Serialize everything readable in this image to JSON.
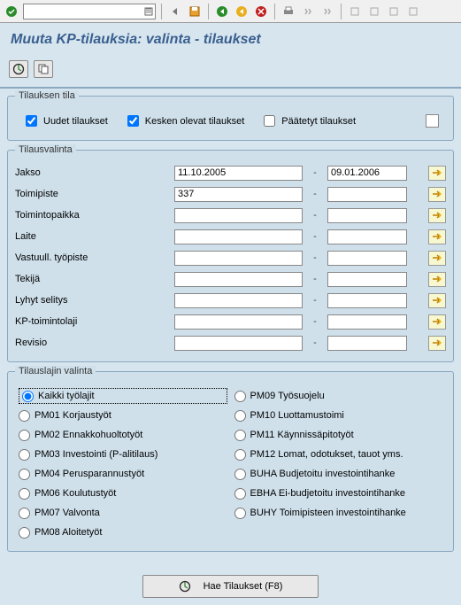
{
  "title": "Muuta KP-tilauksia: valinta - tilaukset",
  "status": {
    "group_title": "Tilauksen tila",
    "new": "Uudet tilaukset",
    "open": "Kesken olevat tilaukset",
    "closed": "Päätetyt tilaukset",
    "new_checked": true,
    "open_checked": true,
    "closed_checked": false
  },
  "selection": {
    "group_title": "Tilausvalinta",
    "rows": [
      {
        "label": "Jakso",
        "from": "11.10.2005",
        "to": "09.01.2006"
      },
      {
        "label": "Toimipiste",
        "from": "337",
        "to": ""
      },
      {
        "label": "Toimintopaikka",
        "from": "",
        "to": ""
      },
      {
        "label": "Laite",
        "from": "",
        "to": ""
      },
      {
        "label": "Vastuull. työpiste",
        "from": "",
        "to": ""
      },
      {
        "label": "Tekijä",
        "from": "",
        "to": ""
      },
      {
        "label": "Lyhyt selitys",
        "from": "",
        "to": ""
      },
      {
        "label": "KP-toimintolaji",
        "from": "",
        "to": ""
      },
      {
        "label": "Revisio",
        "from": "",
        "to": ""
      }
    ]
  },
  "ordertype": {
    "group_title": "Tilauslajin valinta",
    "left": [
      "Kaikki työlajit",
      "PM01 Korjaustyöt",
      "PM02 Ennakkohuoltotyöt",
      "PM03 Investointi (P-alitilaus)",
      "PM04 Perusparannustyöt",
      "PM06 Koulutustyöt",
      "PM07 Valvonta",
      "PM08 Aloitetyöt"
    ],
    "right": [
      "PM09 Työsuojelu",
      "PM10 Luottamustoimi",
      "PM11 Käynnissäpitotyöt",
      "PM12 Lomat, odotukset, tauot yms.",
      "BUHA Budjetoitu investointihanke",
      "EBHA Ei-budjetoitu investointihanke",
      "BUHY Toimipisteen investointihanke"
    ],
    "selected_index": 0
  },
  "footer": {
    "exec_label": "Hae Tilaukset (F8)"
  }
}
